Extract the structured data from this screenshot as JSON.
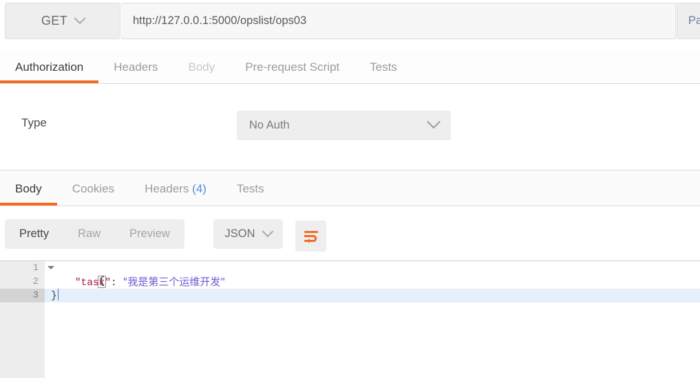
{
  "request_bar": {
    "method": "GET",
    "method_icon": "chevron-down-icon",
    "url": "http://127.0.0.1:5000/opslist/ops03",
    "params_label": "Params"
  },
  "request_tabs": [
    {
      "label": "Authorization",
      "state": "active"
    },
    {
      "label": "Headers",
      "state": "normal"
    },
    {
      "label": "Body",
      "state": "disabled"
    },
    {
      "label": "Pre-request Script",
      "state": "normal"
    },
    {
      "label": "Tests",
      "state": "normal"
    }
  ],
  "auth_panel": {
    "type_label": "Type",
    "type_value": "No Auth",
    "dropdown_icon": "chevron-down-icon"
  },
  "response_tabs": [
    {
      "label": "Body",
      "count": "",
      "state": "active"
    },
    {
      "label": "Cookies",
      "count": "",
      "state": "normal"
    },
    {
      "label": "Headers",
      "count": "(4)",
      "state": "normal"
    },
    {
      "label": "Tests",
      "count": "",
      "state": "normal"
    }
  ],
  "response_toolbar": {
    "view_modes": [
      {
        "label": "Pretty",
        "state": "active"
      },
      {
        "label": "Raw",
        "state": "normal"
      },
      {
        "label": "Preview",
        "state": "normal"
      }
    ],
    "format": "JSON",
    "format_icon": "chevron-down-icon",
    "wrap_icon": "word-wrap-icon"
  },
  "code": {
    "lines": [
      {
        "number": "1",
        "foldable": true,
        "active": false,
        "open_brace": "{"
      },
      {
        "number": "2",
        "foldable": false,
        "active": false,
        "indent": "    ",
        "key": "\"task\"",
        "colon": ": ",
        "value": "\"我是第三个运维开发\""
      },
      {
        "number": "3",
        "foldable": false,
        "active": true,
        "close_brace": "}"
      }
    ]
  },
  "colors": {
    "accent_orange": "#f26b21",
    "link_blue": "#4a90d9",
    "json_key": "#a3174b",
    "json_string": "#6b5bd2",
    "active_line": "#e6f0fb",
    "toolbar_grey": "#eeeeee"
  }
}
